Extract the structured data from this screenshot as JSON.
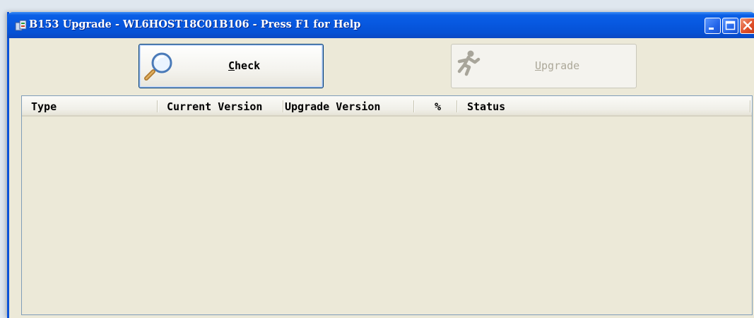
{
  "window": {
    "title": "B153 Upgrade - WL6HOST18C01B106 - Press F1 for Help",
    "app_icon": "installer-icon",
    "controls": [
      "minimize-icon",
      "maximize-icon",
      "close-icon"
    ]
  },
  "toolbar": {
    "check": {
      "label": "Check",
      "icon": "magnifier-icon",
      "enabled": true
    },
    "upgrade": {
      "label": "Upgrade",
      "icon": "running-man-icon",
      "enabled": false
    }
  },
  "table": {
    "columns": [
      "Type",
      "Current Version",
      "Upgrade Version",
      "%",
      "Status"
    ],
    "rows": []
  },
  "colors": {
    "titlebar": "#0758e0",
    "window_bg": "#ece9d8",
    "disabled_text": "#aca899"
  }
}
